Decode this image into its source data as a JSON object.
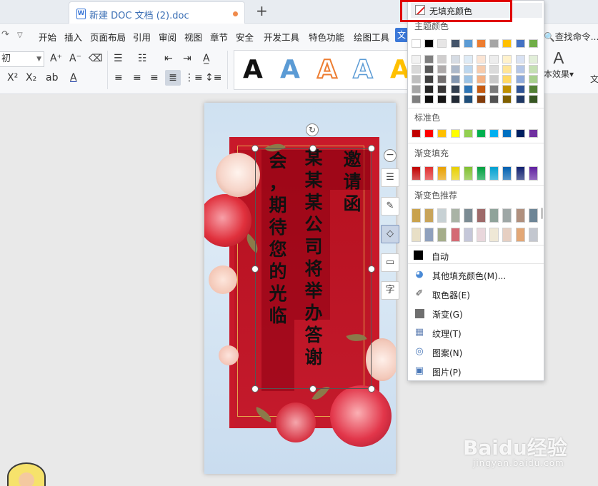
{
  "titlebar": {
    "tab_title": "新建 DOC 文档 (2).doc",
    "new_tab_label": "+",
    "doc_icon_letter": "W"
  },
  "menu": {
    "items": [
      "开始",
      "插入",
      "页面布局",
      "引用",
      "审阅",
      "视图",
      "章节",
      "安全",
      "开发工具",
      "特色功能",
      "绘图工具"
    ],
    "active_tab": "文",
    "search_label": "查找命令..."
  },
  "ribbon": {
    "font_size": "初",
    "style_letter": "A",
    "text_effect_label": "本效果",
    "right_edge_label": "文"
  },
  "document": {
    "columns": [
      {
        "text": "邀请函"
      },
      {
        "text": "某某某公司将举办答谢"
      },
      {
        "text": "会，期待您的光临"
      }
    ]
  },
  "dropdown": {
    "no_fill_label": "无填充颜色",
    "theme_colors_title": "主题颜色",
    "standard_colors_title": "标准色",
    "gradient_fill_title": "渐变填充",
    "gradient_recommend_title": "渐变色推荐",
    "auto_label": "自动",
    "menu_items": [
      {
        "icon": "palette-icon",
        "label": "其他填充颜色(M)..."
      },
      {
        "icon": "eyedropper-icon",
        "label": "取色器(E)"
      },
      {
        "icon": "gradient-icon",
        "label": "渐变(G)"
      },
      {
        "icon": "texture-icon",
        "label": "纹理(T)"
      },
      {
        "icon": "pattern-icon",
        "label": "图案(N)"
      },
      {
        "icon": "picture-icon",
        "label": "图片(P)"
      }
    ],
    "theme_top_row": [
      "#ffffff",
      "#000000",
      "#e7e6e6",
      "#44546a",
      "#5b9bd5",
      "#ed7d31",
      "#a5a5a5",
      "#ffc000",
      "#4472c4",
      "#70ad47"
    ],
    "theme_shade_columns": [
      [
        "#f2f2f2",
        "#d9d9d9",
        "#bfbfbf",
        "#a6a6a6",
        "#7f7f7f"
      ],
      [
        "#7f7f7f",
        "#595959",
        "#404040",
        "#262626",
        "#0d0d0d"
      ],
      [
        "#d0cece",
        "#aeaaaa",
        "#757171",
        "#3a3838",
        "#171616"
      ],
      [
        "#d6dce4",
        "#adb9ca",
        "#8497b0",
        "#333f4f",
        "#222a35"
      ],
      [
        "#deebf6",
        "#bdd7ee",
        "#9cc3e5",
        "#2e75b5",
        "#1f4e79"
      ],
      [
        "#fbe5d5",
        "#f7cbac",
        "#f4b183",
        "#c55a11",
        "#833c0b"
      ],
      [
        "#ededed",
        "#dbdbdb",
        "#c9c9c9",
        "#7b7b7b",
        "#525252"
      ],
      [
        "#fff2cc",
        "#ffe598",
        "#ffd965",
        "#bf9000",
        "#7f6000"
      ],
      [
        "#d9e2f3",
        "#b4c6e7",
        "#8eaadb",
        "#2f5496",
        "#1f3864"
      ],
      [
        "#e2efd9",
        "#c5e0b3",
        "#a8d08d",
        "#538135",
        "#375623"
      ]
    ],
    "standard_colors": [
      "#c00000",
      "#ff0000",
      "#ffc000",
      "#ffff00",
      "#92d050",
      "#00b050",
      "#00b0f0",
      "#0070c0",
      "#002060",
      "#7030a0"
    ],
    "gradient_fill": [
      "#c00000",
      "#e03030",
      "#e8a000",
      "#e8d000",
      "#80c030",
      "#00a040",
      "#00a0d0",
      "#0060b0",
      "#102070",
      "#6020a0"
    ],
    "gradient_recommend_row1": [
      "#c9a24d",
      "#c8a45a",
      "#c7d1d4",
      "#a9b3a5",
      "#7b8b93",
      "#9e6a6a",
      "#8fa39a",
      "#9ea7a6",
      "#b0907e",
      "#6d8596"
    ],
    "gradient_recommend_row2": [
      "#e8dfc6",
      "#8fa0bd",
      "#a5ad8a",
      "#d46a74",
      "#c5c7d9",
      "#e9d7dc",
      "#efe8d6",
      "#e6cfc2",
      "#e3a775",
      "#c3c7cf"
    ]
  },
  "watermark": {
    "main": "Baidu经验",
    "sub": "jingyan.baidu.com"
  }
}
